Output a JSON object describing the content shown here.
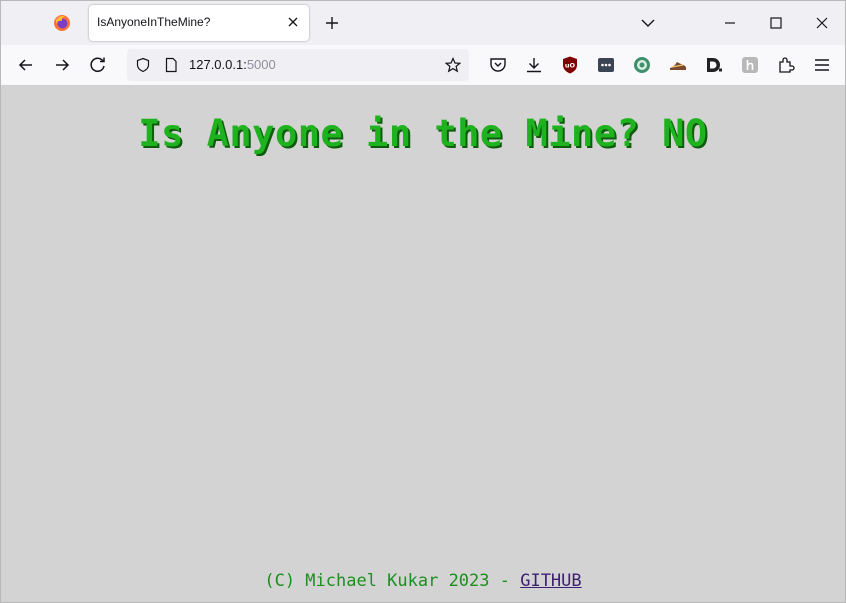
{
  "browser": {
    "tab": {
      "title": "IsAnyoneInTheMine?"
    },
    "url": {
      "host": "127.0.0.1:",
      "port": "5000"
    }
  },
  "page": {
    "heading": "Is Anyone in the Mine? NO",
    "footer": {
      "text": "(C) Michael Kukar 2023 - ",
      "link_label": "GITHUB"
    }
  },
  "colors": {
    "page_background": "#d3d3d3",
    "heading": "#1fb21f",
    "footer_link": "#3d1f73"
  },
  "icons": {
    "toolbar": [
      "pocket-icon",
      "download-icon",
      "ublock-icon",
      "password-manager-icon",
      "extension-green-icon",
      "extension-shoe-icon",
      "extension-d-icon",
      "extension-h-icon",
      "extensions-icon",
      "menu-icon"
    ]
  }
}
